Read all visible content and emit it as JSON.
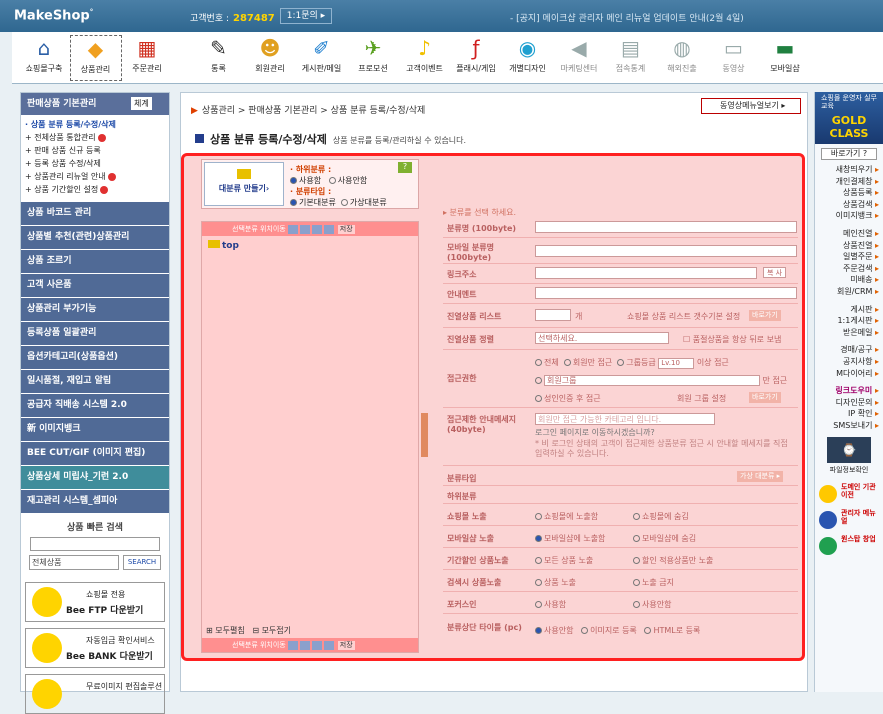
{
  "topbar": {
    "logo": "MakeShop",
    "logo_sup": "°",
    "cust_label": "고객번호 :",
    "cust_no": "287487",
    "qna": "1:1문의 ▸",
    "notice": "- [공지] 메이크샵 관리자 메인 리뉴얼 업데이트 안내(2월 4일)"
  },
  "menu": [
    {
      "label": "쇼핑몰구축",
      "icon": "home-icon",
      "glyph": "⌂",
      "color": "#2b5fa6"
    },
    {
      "label": "상품관리",
      "icon": "tag-icon",
      "glyph": "◆",
      "color": "#f0a020"
    },
    {
      "label": "주문관리",
      "icon": "cart-icon",
      "glyph": "▦",
      "color": "#d03020"
    },
    {
      "label": "통록",
      "icon": "hot-icon",
      "glyph": "✎",
      "color": "#333"
    },
    {
      "label": "회원관리",
      "icon": "member-icon",
      "glyph": "☻",
      "color": "#e0a020"
    },
    {
      "label": "게시판/메일",
      "icon": "board-icon",
      "glyph": "✐",
      "color": "#2080d0"
    },
    {
      "label": "프로모션",
      "icon": "promo-icon",
      "glyph": "✈",
      "color": "#5aa020"
    },
    {
      "label": "고객이벤트",
      "icon": "event-icon",
      "glyph": "♪",
      "color": "#f0c000"
    },
    {
      "label": "플래시/게임",
      "icon": "flash-icon",
      "glyph": "ƒ",
      "color": "#d02020"
    },
    {
      "label": "개별디자인",
      "icon": "design-icon",
      "glyph": "◉",
      "color": "#20a0d0"
    },
    {
      "label": "마케팅센터",
      "icon": "marketing-icon",
      "glyph": "◀",
      "color": "#9aa"
    },
    {
      "label": "접속통계",
      "icon": "stats-icon",
      "glyph": "▤",
      "color": "#9aa"
    },
    {
      "label": "해외진출",
      "icon": "global-icon",
      "glyph": "◍",
      "color": "#9aa"
    },
    {
      "label": "동영상",
      "icon": "video-icon",
      "glyph": "▭",
      "color": "#9aa"
    },
    {
      "label": "모바일샵",
      "icon": "mobile-icon",
      "glyph": "▬",
      "color": "#208040"
    }
  ],
  "sidebar": {
    "head": "판매상품 기본관리",
    "head_sel": "체계",
    "subs": [
      "· 상품 분류 등록/수정/삭제",
      "+ 전체상품 통합관리",
      "+ 판매 상품 신규 등록",
      "+ 등록 상품 수정/삭제",
      "+ 상품관리 리뉴얼 안내",
      "+ 상품 기간할인 설정"
    ],
    "cats": [
      "상품 바코드 관리",
      "상품별 추천(관련)상품관리",
      "상품 조르기",
      "고객 사은품",
      "상품관리 부가기능",
      "등록상품 일괄관리",
      "옵션카테고리(상품옵션)",
      "일시품절, 재입고 알림",
      "공급자 직배송 시스템 2.0",
      "新 이미지뱅크",
      "BEE CUT/GIF (이미지 편집)",
      "상품상세 미립샤_기런 2.0",
      "재고관리 시스템_셈피아"
    ],
    "qs_title": "상품 빠른 검색",
    "qs_select": "전체상품",
    "qs_btn": "SEARCH",
    "ban1_a": "쇼핑몰 전용",
    "ban1_b": "Bee FTP 다운받기",
    "ban2_a": "자동입금 확인서비스",
    "ban2_b": "Bee BANK 다운받기",
    "ban3_a": "무료이미지 편집솔루션"
  },
  "main": {
    "crumb": "상품관리 > 판매상품 기본관리 > 상품 분류 등록/수정/삭제",
    "video_btn": "동영상메뉴얼보기 ▸",
    "title": "상품 분류 등록/수정/삭제",
    "desc": "상품 분류를 등록/관리하실 수 있습니다.",
    "make_btn": "대분류 만들기›",
    "upper_lbl": "· 하위분류 :",
    "upper_opts": [
      "사용함",
      "사용안함"
    ],
    "type_lbl": "· 분류타입 :",
    "type_opts": [
      "기본대분류",
      "가상대분류"
    ],
    "tree_head": "선택분류 위치이동",
    "tree_save": "저장",
    "root": "top",
    "expand_all": "⊞ 모두펼침",
    "collapse_all": "⊟ 모두접기",
    "tree_foot": "선택분류 위치이동",
    "select_hint": "▸ 분류를 선택 하세요.",
    "rows": {
      "name": "분류명 (100byte)",
      "mname": "모바일 분류명 (100byte)",
      "link": "링크주소",
      "link_btn": "복 사",
      "guide": "안내멘트",
      "list": "진열상품 리스트",
      "list_unit": "개",
      "list_note": "쇼핑몰 상품 리스트 갯수기본 설정",
      "list_btn": "바로가기",
      "sort": "진열상품 정렬",
      "sort_sel": "선택하세요.",
      "sort_chk": "품절상품을 항상 뒤로 보냄",
      "perm": "접근권한",
      "perm_all": "전체",
      "perm_member": "회원만 접근",
      "perm_group": "그룹등급",
      "perm_lv": "Lv.10",
      "perm_above": "이상 접근",
      "perm_grp_sel": "회원그룹",
      "perm_only": "만 접근",
      "perm_adult": "성인인증 후 접근",
      "perm_note": "회원 그룹 설정",
      "perm_btn": "바로가기",
      "deny": "접근제한 안내메세지 (40byte)",
      "deny_ph": "회원만 접근 가능한 카테고리 입니다.",
      "deny_q": "로그인 페이지로 이동하시겠습니까?",
      "deny_n": "* 비 로그인 상태의 고객이 접근제한 상품분류 접근 시 안내할 메세지를 직접 입력하실 수 있습니다.",
      "type": "분류타입",
      "type_btn": "가상 대분류 ▸",
      "sub": "하위분류",
      "shop": "쇼핑몰 노출",
      "shop_o1": "쇼핑몰에 노출함",
      "shop_o2": "쇼핑몰에 숨김",
      "mob": "모바일샵 노출",
      "mob_o1": "모바일샵에 노출함",
      "mob_o2": "모바일샵에 숨김",
      "disc": "기간할인 상품노출",
      "disc_o1": "모든 상품 노출",
      "disc_o2": "할인 적용상품만 노출",
      "search": "검색시 상품노출",
      "search_o1": "상품 노출",
      "search_o2": "노출 금지",
      "focus": "포커스인",
      "focus_o1": "사용함",
      "focus_o2": "사용안함",
      "top": "분류상단 타이틀 (pc)",
      "top_o1": "사용안함",
      "top_o2": "이미지로 등록",
      "top_o3": "HTML로 등록"
    }
  },
  "right": {
    "gold_small": "쇼핑몰 운영자 실무교육",
    "gold": "GOLD CLASS",
    "shortcut": "바로가기 ?",
    "links": [
      {
        "t": "새창띄우기",
        "h": false
      },
      {
        "t": "개인결제창",
        "h": false
      },
      {
        "t": "상품등록",
        "h": false
      },
      {
        "t": "상품검색",
        "h": false
      },
      {
        "t": "이미지뱅크",
        "h": false
      },
      {
        "t": "메인진열",
        "h": false
      },
      {
        "t": "상품진열",
        "h": false
      },
      {
        "t": "일별주문",
        "h": false
      },
      {
        "t": "주문검색",
        "h": false
      },
      {
        "t": "미배송",
        "h": false
      },
      {
        "t": "회원/CRM",
        "h": false
      },
      {
        "t": "게시판",
        "h": false
      },
      {
        "t": "1:1게시판",
        "h": false
      },
      {
        "t": "받은메일",
        "h": false
      },
      {
        "t": "경매/공구",
        "h": false
      },
      {
        "t": "공지사항",
        "h": false
      },
      {
        "t": "M다이어리",
        "h": false
      },
      {
        "t": "링크도우미",
        "h": true
      },
      {
        "t": "디자인문의",
        "h": false
      },
      {
        "t": "IP 확인",
        "h": false
      },
      {
        "t": "SMS보내기",
        "h": false
      }
    ],
    "cam": "파일정보확인",
    "btn1": "도메인 기관이전",
    "btn2": "관리자 메뉴얼",
    "btn3": "원스탑 창업"
  }
}
